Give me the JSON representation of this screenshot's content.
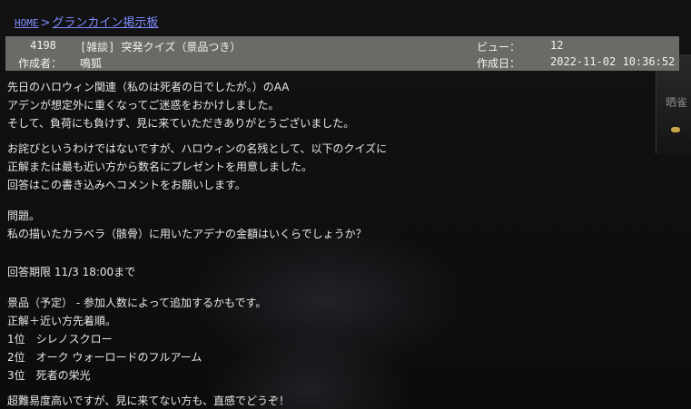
{
  "breadcrumb": {
    "home": "HOME",
    "separator": ">",
    "board": "グランカイン掲示板"
  },
  "post_header": {
    "number": "4198",
    "title": "[雑談] 突発クイズ（景品つき）",
    "views_label": "ビュー：",
    "views_value": "12",
    "author_label": "作成者：",
    "author_value": "鳴狐",
    "date_label": "作成日：",
    "date_value": "2022-11-02 10:36:52"
  },
  "right_fragment": "晒雀",
  "body": {
    "para1": [
      "先日のハロウィン関連（私のは死者の日でしたが。）のAA",
      "アデンが想定外に重くなってご迷惑をおかけしました。",
      "そして、負荷にも負けず、見に来ていただきありがとうございました。"
    ],
    "para2": [
      "お詫びというわけではないですが、ハロウィンの名残として、以下のクイズに",
      "正解または最も近い方から数名にプレゼントを用意しました。",
      "回答はこの書き込みへコメントをお願いします。"
    ],
    "para3": [
      "問題。",
      "私の描いたカラベラ（骸骨）に用いたアデナの金額はいくらでしょうか？"
    ],
    "deadline": "回答期限 11/3 18:00まで",
    "para4": [
      "景品（予定） - 参加人数によって追加するかもです。",
      "正解＋近い方先着順。",
      "1位　シレノスクロー",
      "2位　オーク ウォーロードのフルアーム",
      "3位　死者の栄光"
    ],
    "closing": "超難易度高いですが、見に来てない方も、直感でどうぞ！"
  }
}
